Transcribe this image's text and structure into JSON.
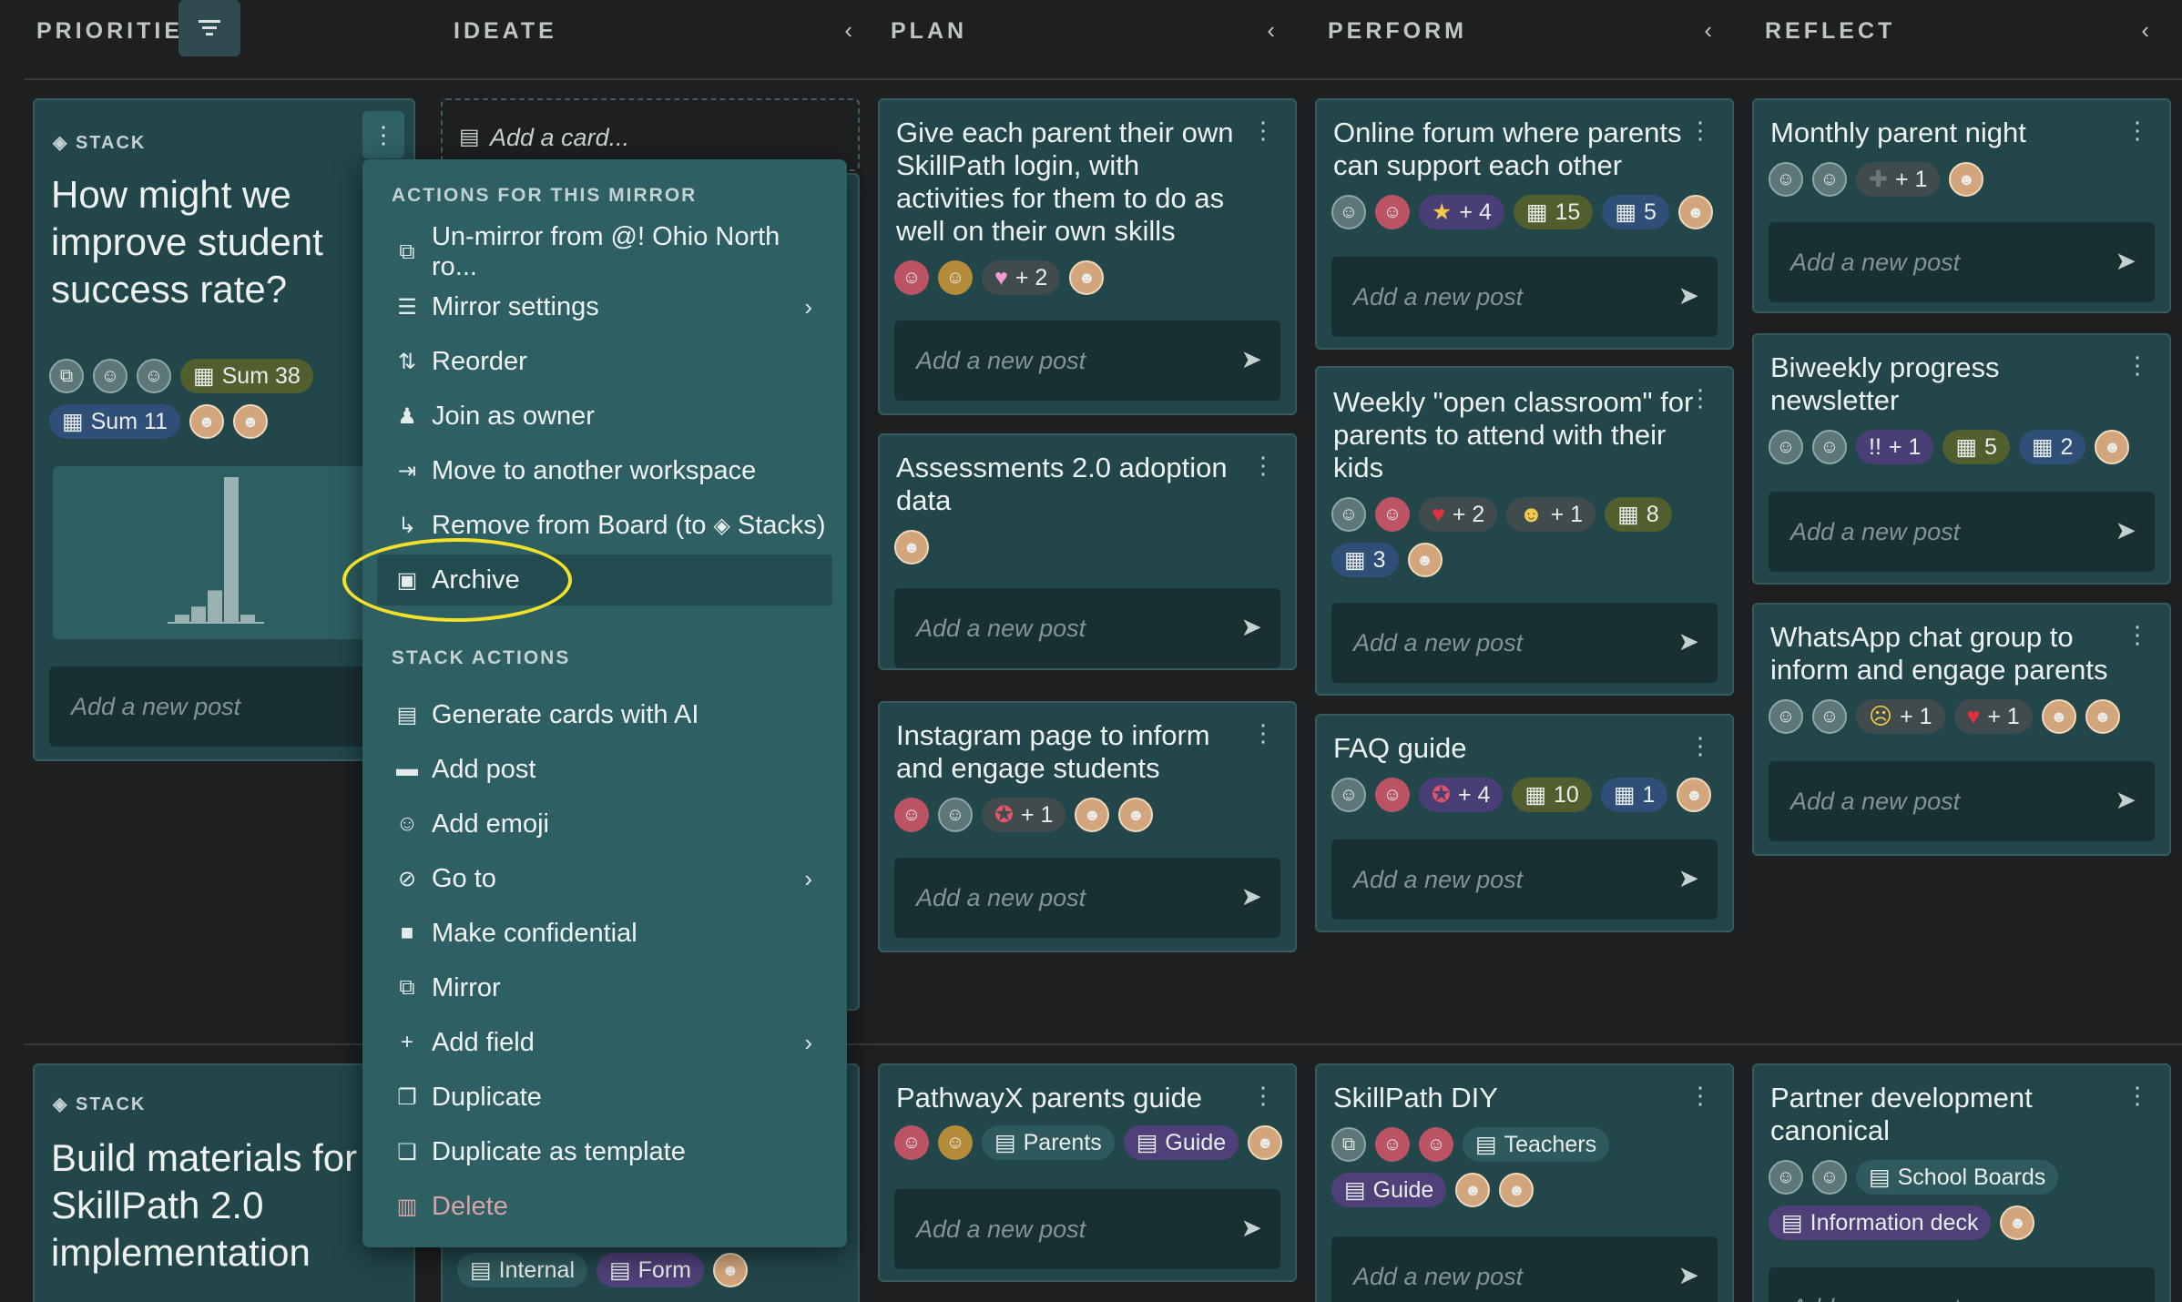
{
  "columns": {
    "priorities": "PRIORITIES",
    "ideate": "IDEATE",
    "plan": "PLAN",
    "perform": "PERFORM",
    "reflect": "REFLECT",
    "collapse_icon": "‹",
    "filter_icon": "filter-icon"
  },
  "stack1": {
    "label": "STACK",
    "title": "How might we improve student success rate?",
    "sum1": "Sum 38",
    "sum2": "Sum 11",
    "add_post": "Add a new post",
    "chart_data": {
      "type": "bar",
      "values": [
        1,
        2,
        4,
        18,
        1
      ],
      "categories": [],
      "title": "",
      "xlabel": "",
      "ylabel": ""
    }
  },
  "stack2": {
    "label": "STACK",
    "title": "Build materials for SkillPath 2.0 implementation"
  },
  "ideate": {
    "add_card": "Add a card...",
    "tag_internal": "Internal",
    "tag_form": "Form"
  },
  "menu": {
    "section1": "ACTIONS FOR THIS MIRROR",
    "section2": "STACK ACTIONS",
    "items": [
      "Un-mirror from @! Ohio North ro...",
      "Mirror settings",
      "Reorder",
      "Join as owner",
      "Move to another workspace",
      "Remove from Board (to",
      "Stacks)",
      "Archive",
      "Generate cards with AI",
      "Add post",
      "Add emoji",
      "Go to",
      "Make confidential",
      "Mirror",
      "Add field",
      "Duplicate",
      "Duplicate as template",
      "Delete"
    ]
  },
  "plan": {
    "c1": {
      "title": "Give each parent their own SkillPath login, with activities for them to do as well on their own skills",
      "count": "+ 2"
    },
    "c2": {
      "title": "Assessments 2.0 adoption data"
    },
    "c3": {
      "title": "Instagram page to inform and engage students",
      "count": "+ 1"
    },
    "c4": {
      "title": "PathwayX parents guide",
      "tag1": "Parents",
      "tag2": "Guide"
    }
  },
  "perform": {
    "c1": {
      "title": "Online forum where parents can support each other",
      "count": "+ 4",
      "n1": "15",
      "n2": "5"
    },
    "c2": {
      "title": "Weekly \"open classroom\" for parents to attend with their kids",
      "count1": "+ 2",
      "count2": "+ 1",
      "n1": "8",
      "n2": "3"
    },
    "c3": {
      "title": "FAQ guide",
      "count": "+ 4",
      "n1": "10",
      "n2": "1"
    },
    "c4": {
      "title": "SkillPath DIY",
      "tag1": "Teachers",
      "tag2": "Guide"
    }
  },
  "reflect": {
    "c1": {
      "title": "Monthly parent night",
      "count": "+ 1"
    },
    "c2": {
      "title": "Biweekly progress newsletter",
      "count": "+ 1",
      "bang": "!!",
      "n1": "5",
      "n2": "2"
    },
    "c3": {
      "title": "WhatsApp chat group to inform and engage parents",
      "count1": "+ 1",
      "count2": "+ 1"
    },
    "c4": {
      "title": "Partner development canonical",
      "tag1": "School Boards",
      "tag2": "Information deck"
    }
  },
  "common": {
    "add_post": "Add a new post"
  }
}
